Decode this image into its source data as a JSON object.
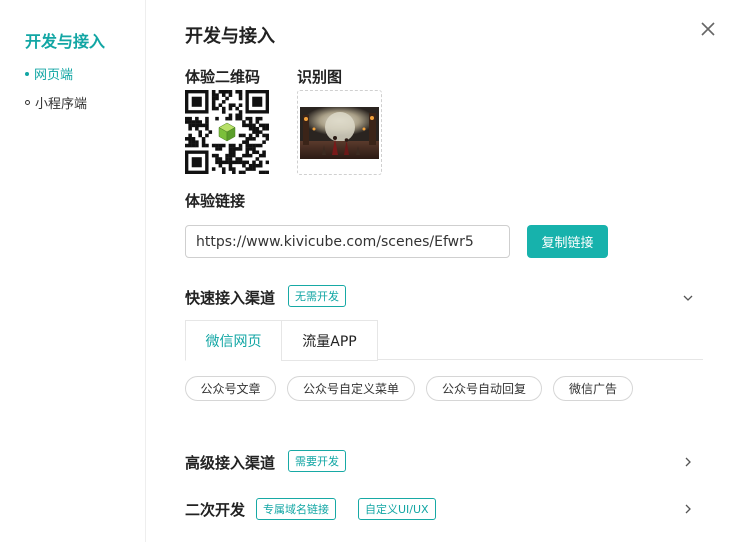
{
  "sidebar": {
    "title": "开发与接入",
    "items": [
      {
        "label": "网页端"
      },
      {
        "label": "小程序端"
      }
    ]
  },
  "main": {
    "title": "开发与接入",
    "qr_label": "体验二维码",
    "image_label": "识别图",
    "link_label": "体验链接",
    "link_value": "https://www.kivicube.com/scenes/Efwr5",
    "copy_button": "复制链接",
    "quick": {
      "title": "快速接入渠道",
      "tag": "无需开发",
      "tabs": [
        {
          "label": "微信网页"
        },
        {
          "label": "流量APP"
        }
      ],
      "chips": [
        "公众号文章",
        "公众号自定义菜单",
        "公众号自动回复",
        "微信广告"
      ]
    },
    "advanced": {
      "title": "高级接入渠道",
      "tag": "需要开发"
    },
    "secondary": {
      "title": "二次开发",
      "tags": [
        "专属域名链接",
        "自定义UI/UX"
      ]
    }
  },
  "colors": {
    "accent": "#12a6a4",
    "button": "#17b2ac"
  },
  "icons": {
    "close": "close-icon",
    "collapse": "chevron-down-icon",
    "expand": "chevron-right-icon",
    "qr": "qr-code-icon",
    "cube": "cube-logo-icon"
  }
}
